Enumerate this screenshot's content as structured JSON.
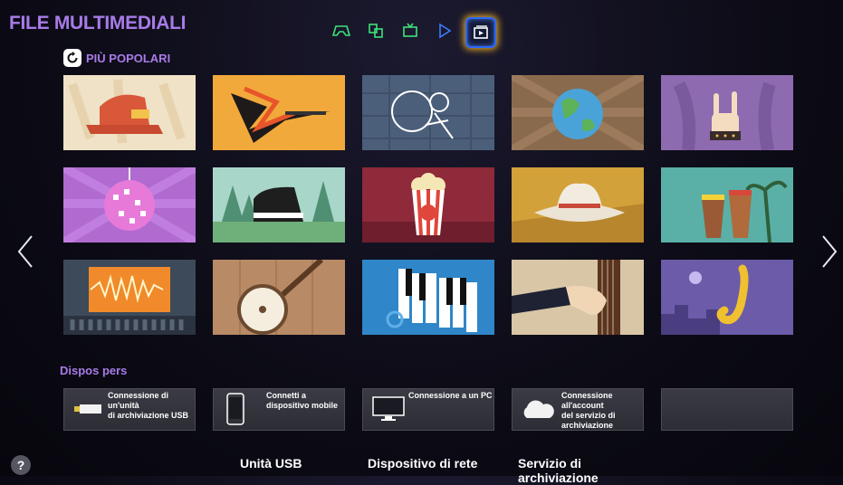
{
  "app": {
    "title": "FILE MULTIMEDIALI"
  },
  "mode_bar": {
    "icons": [
      "gamepad-icon",
      "apps-icon",
      "tv-icon",
      "play-icon",
      "multimedia-icon"
    ],
    "active": "multimedia-icon"
  },
  "popular": {
    "title": "PIÙ POPOLARI"
  },
  "genres": [
    {
      "icon": "hiphop-cap-icon",
      "bg": "#efe2c6"
    },
    {
      "icon": "rock-guitar-icon",
      "bg": "#f2a93b"
    },
    {
      "icon": "neon-guitarist-icon",
      "bg": "#4b5f7a"
    },
    {
      "icon": "world-globe-icon",
      "bg": "#8a6a4d"
    },
    {
      "icon": "metal-hand-icon",
      "bg": "#8e6ab0"
    },
    {
      "icon": "disco-ball-icon",
      "bg": "#b06ad0"
    },
    {
      "icon": "piano-forest-icon",
      "bg": "#7fb2a6"
    },
    {
      "icon": "popcorn-icon",
      "bg": "#8e2a3a"
    },
    {
      "icon": "cowboy-hat-icon",
      "bg": "#d3a13a"
    },
    {
      "icon": "conga-drums-icon",
      "bg": "#5ab0a6"
    },
    {
      "icon": "sound-wave-icon",
      "bg": "#3d4a5a"
    },
    {
      "icon": "banjo-icon",
      "bg": "#b98a66"
    },
    {
      "icon": "piano-keys-icon",
      "bg": "#2f86c8"
    },
    {
      "icon": "double-bass-icon",
      "bg": "#d8c6a6"
    },
    {
      "icon": "saxophone-icon",
      "bg": "#6b5ba8"
    }
  ],
  "devices": {
    "label": "Dispos pers",
    "cards": [
      {
        "icon": "usb-icon",
        "line1": "Connessione di un'unità",
        "line2": "di archiviazione USB"
      },
      {
        "icon": "phone-icon",
        "line1": "Connetti a",
        "line2": "dispositivo mobile"
      },
      {
        "icon": "monitor-icon",
        "line1": "Connessione a un PC",
        "line2": ""
      },
      {
        "icon": "cloud-icon",
        "line1": "Connessione",
        "line2": "all'account",
        "line3": "del servizio di",
        "line4": "archiviazione"
      },
      {
        "icon": "",
        "line1": "",
        "line2": ""
      }
    ]
  },
  "categories": [
    "Unità USB",
    "Dispositivo di rete",
    "Servizio di archiviazione"
  ],
  "help": {
    "label": "?"
  }
}
